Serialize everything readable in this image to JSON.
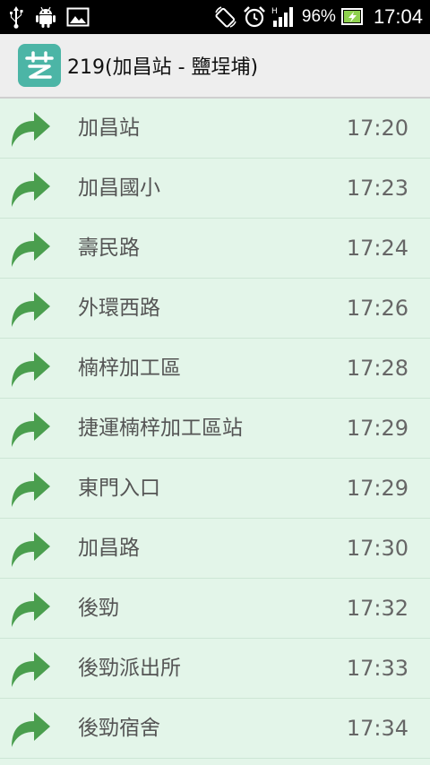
{
  "status_bar": {
    "battery": "96%",
    "time": "17:04",
    "icons": [
      "usb-icon",
      "android-icon",
      "image-icon",
      "rotate-icon",
      "alarm-icon",
      "signal-icon",
      "battery-icon"
    ]
  },
  "header": {
    "title": "219(加昌站 - 鹽埕埔)",
    "logo_icon": "bus-app-logo",
    "accent": "#4cb5a6"
  },
  "stops": [
    {
      "name": "加昌站",
      "time": "17:20"
    },
    {
      "name": "加昌國小",
      "time": "17:23"
    },
    {
      "name": "壽民路",
      "time": "17:24"
    },
    {
      "name": "外環西路",
      "time": "17:26"
    },
    {
      "name": "楠梓加工區",
      "time": "17:28"
    },
    {
      "name": "捷運楠梓加工區站",
      "time": "17:29"
    },
    {
      "name": "東門入口",
      "time": "17:29"
    },
    {
      "name": "加昌路",
      "time": "17:30"
    },
    {
      "name": "後勁",
      "time": "17:32"
    },
    {
      "name": "後勁派出所",
      "time": "17:33"
    },
    {
      "name": "後勁宿舍",
      "time": "17:34"
    }
  ],
  "colors": {
    "row_background": "#e3f5e9",
    "arrow_green": "#4a9e4e"
  }
}
